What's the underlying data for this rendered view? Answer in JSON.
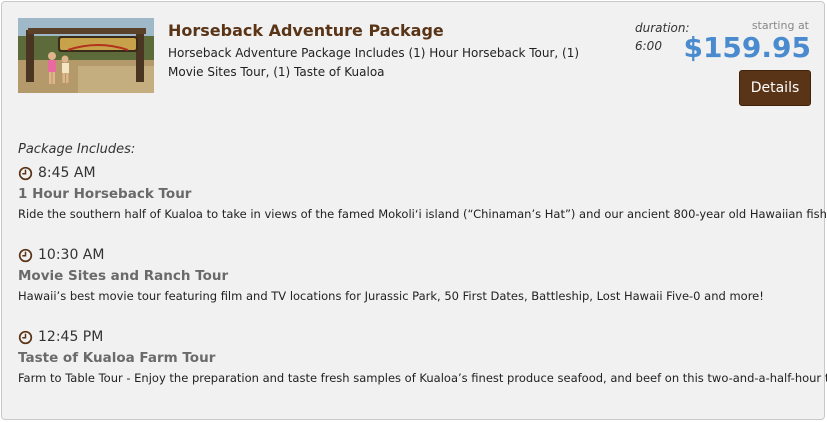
{
  "package": {
    "title": "Horseback Adventure Package",
    "description": "Horseback Adventure Package Includes (1) Hour Horseback Tour, (1) Movie Sites Tour, (1) Taste of Kualoa",
    "duration_label": "duration:",
    "duration_value": "6:00",
    "starting_at_label": "starting at",
    "price": "$159.95",
    "details_button": "Details",
    "image_icon": "jurassic-park-sign-photo"
  },
  "includes": {
    "heading": "Package Includes:",
    "items": [
      {
        "time": "8:45 AM",
        "title": "1 Hour Horseback Tour",
        "description": "Ride the southern half of Kualoa to take in views of the famed Mokoliʻi island (“Chinaman’s Hat”) and our ancient 800-year old Hawaiian fishpond."
      },
      {
        "time": "10:30 AM",
        "title": "Movie Sites and Ranch Tour",
        "description": "Hawaii’s best movie tour featuring film and TV locations for Jurassic Park, 50 First Dates, Battleship, Lost Hawaii Five-0 and more!"
      },
      {
        "time": "12:45 PM",
        "title": "Taste of Kualoa Farm Tour",
        "description": "Farm to Table Tour - Enjoy the preparation and taste fresh samples of Kualoa’s finest produce seafood, and beef on this two-and-a-half-hour tour."
      }
    ]
  },
  "colors": {
    "title": "#5a3416",
    "price": "#4a8bd0",
    "button_bg": "#5a3416",
    "clock": "#5a3416"
  }
}
